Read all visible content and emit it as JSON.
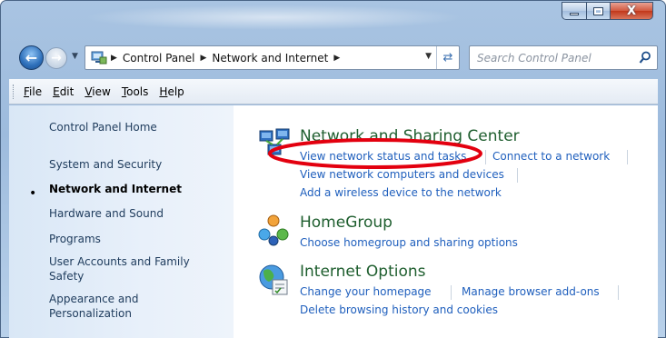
{
  "window": {
    "min_label": "minimize",
    "max_label": "maximize",
    "close_label": "X"
  },
  "navbar": {
    "back_icon": "back-arrow-icon",
    "forward_icon": "forward-arrow-icon",
    "breadcrumbs": [
      "Control Panel",
      "Network and Internet"
    ],
    "search_placeholder": "Search Control Panel"
  },
  "menu": {
    "items": [
      {
        "label": "File",
        "accel": "F"
      },
      {
        "label": "Edit",
        "accel": "E"
      },
      {
        "label": "View",
        "accel": "V"
      },
      {
        "label": "Tools",
        "accel": "T"
      },
      {
        "label": "Help",
        "accel": "H"
      }
    ]
  },
  "sidebar": {
    "items": [
      {
        "label": "Control Panel Home"
      },
      {
        "label": "System and Security"
      },
      {
        "label": "Network and Internet",
        "active": true
      },
      {
        "label": "Hardware and Sound"
      },
      {
        "label": "Programs"
      },
      {
        "label": "User Accounts and Family Safety"
      },
      {
        "label": "Appearance and Personalization"
      }
    ]
  },
  "categories": [
    {
      "title": "Network and Sharing Center",
      "icon": "network-center-icon",
      "tasks": [
        "View network status and tasks",
        "Connect to a network",
        "View network computers and devices",
        "Add a wireless device to the network"
      ]
    },
    {
      "title": "HomeGroup",
      "icon": "homegroup-icon",
      "tasks": [
        "Choose homegroup and sharing options"
      ]
    },
    {
      "title": "Internet Options",
      "icon": "internet-options-icon",
      "tasks": [
        "Change your homepage",
        "Manage browser add-ons",
        "Delete browsing history and cookies"
      ]
    }
  ],
  "annotation": {
    "highlight_color": "#e3000f"
  }
}
